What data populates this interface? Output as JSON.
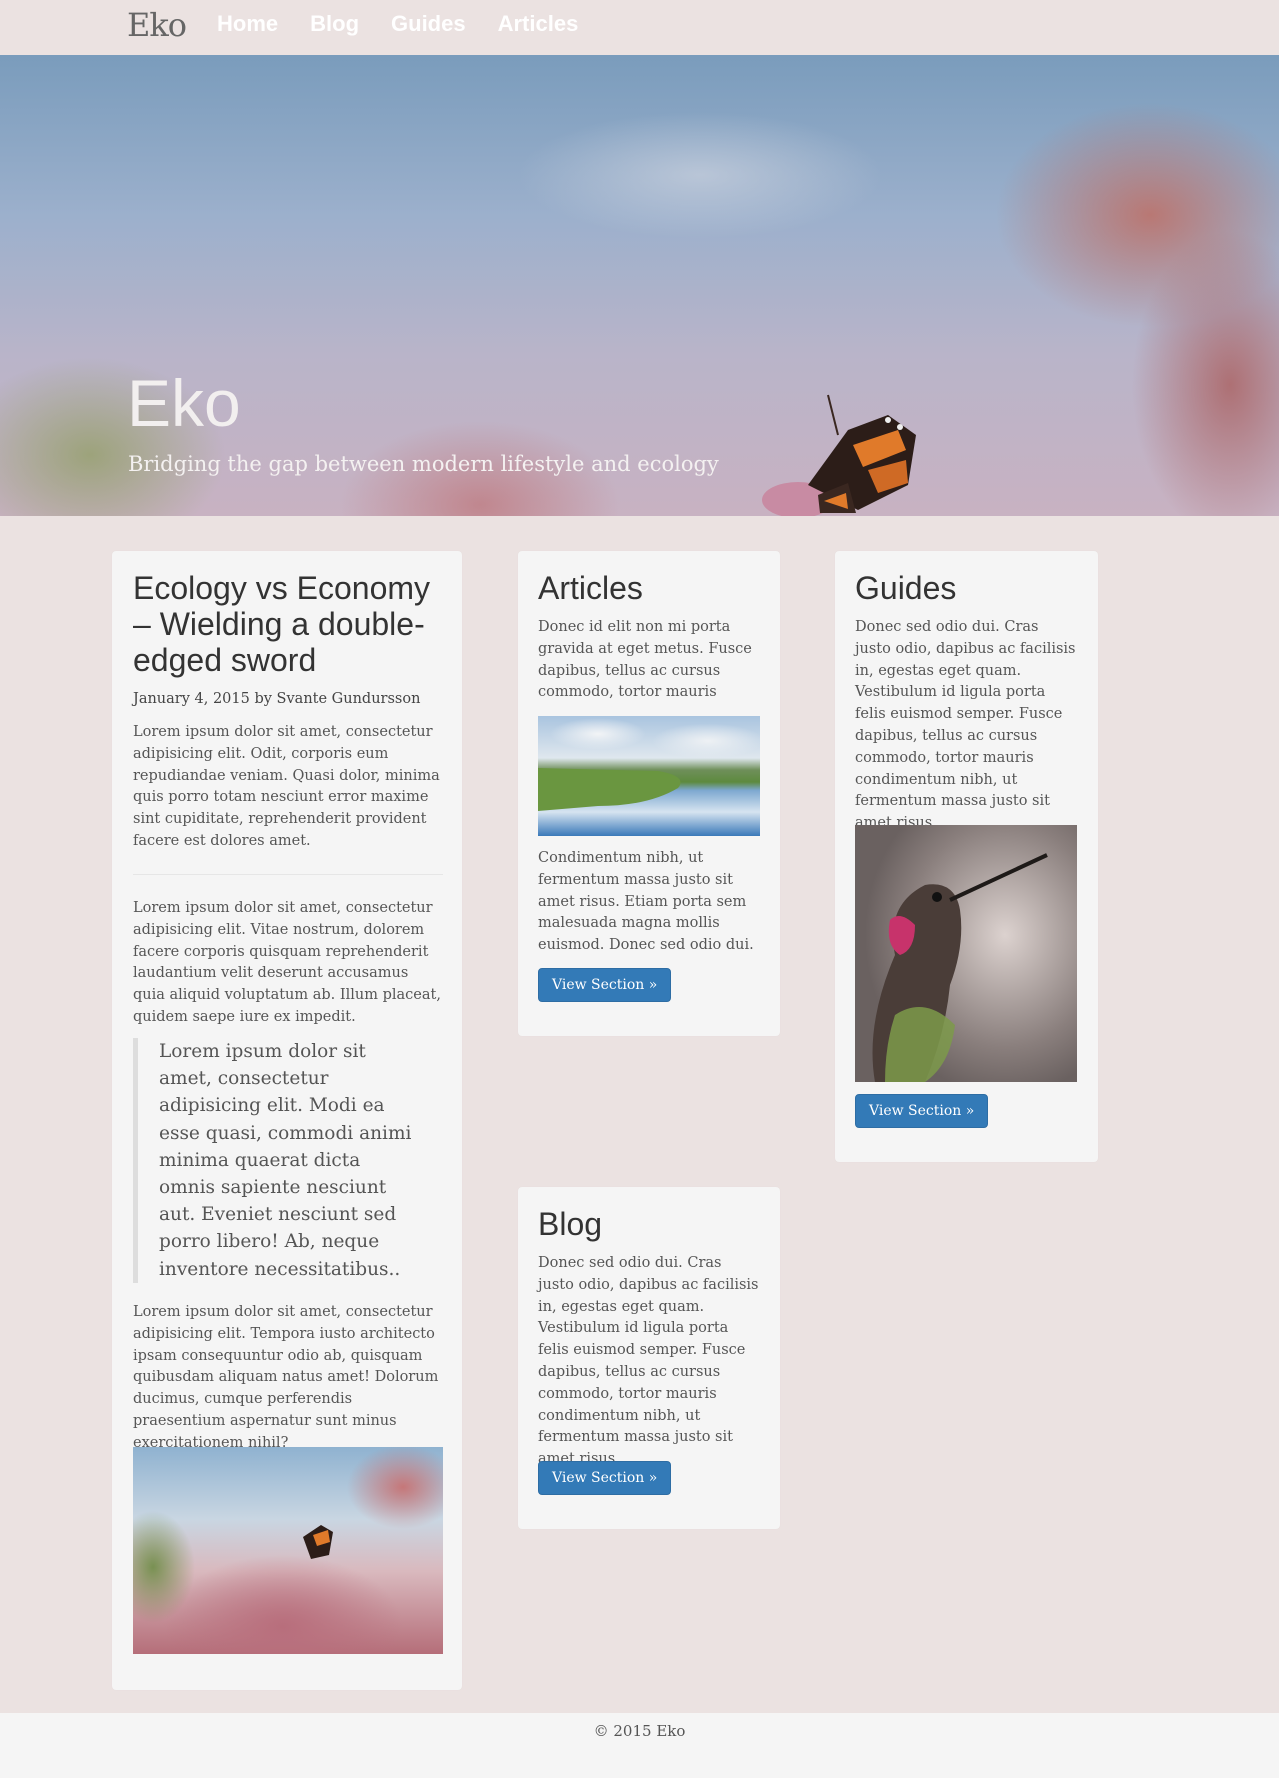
{
  "nav": {
    "brand": "Eko",
    "links": [
      "Home",
      "Blog",
      "Guides",
      "Articles"
    ]
  },
  "hero": {
    "title": "Eko",
    "subtitle": "Bridging the gap between modern lifestyle and ecology"
  },
  "post": {
    "title": "Ecology vs Economy – Wielding a double-edged sword",
    "meta": "January 4, 2015 by Svante Gundursson",
    "para1": "Lorem ipsum dolor sit amet, consectetur adipisicing elit. Odit, corporis eum repudiandae veniam. Quasi dolor, minima quis porro totam nesciunt error maxime sint cupiditate, reprehenderit provident facere est dolores amet.",
    "para2": "Lorem ipsum dolor sit amet, consectetur adipisicing elit. Vitae nostrum, dolorem facere corporis quisquam reprehenderit laudantium velit deserunt accusamus quia aliquid voluptatum ab. Illum placeat, quidem saepe iure ex impedit.",
    "quote": "Lorem ipsum dolor sit amet, consectetur adipisicing elit. Modi ea esse quasi, commodi animi minima quaerat dicta omnis sapiente nesciunt aut. Eveniet nesciunt sed porro libero! Ab, neque inventore necessitatibus..",
    "para3": "Lorem ipsum dolor sit amet, consectetur adipisicing elit. Tempora iusto architecto ipsam consequuntur odio ab, quisquam quibusdam aliquam natus amet! Dolorum ducimus, cumque perferendis praesentium aspernatur sunt minus exercitationem nihil?"
  },
  "articles": {
    "title": "Articles",
    "text1": "Donec id elit non mi porta gravida at eget metus. Fusce dapibus, tellus ac cursus commodo, tortor mauris",
    "text2": "Condimentum nibh, ut fermentum massa justo sit amet risus. Etiam porta sem malesuada magna mollis euismod. Donec sed odio dui.",
    "button": "View Section »"
  },
  "guides": {
    "title": "Guides",
    "text": "Donec sed odio dui. Cras justo odio, dapibus ac facilisis in, egestas eget quam. Vestibulum id ligula porta felis euismod semper. Fusce dapibus, tellus ac cursus commodo, tortor mauris condimentum nibh, ut fermentum massa justo sit amet risus.",
    "button": "View Section »"
  },
  "blog": {
    "title": "Blog",
    "text": "Donec sed odio dui. Cras justo odio, dapibus ac facilisis in, egestas eget quam. Vestibulum id ligula porta felis euismod semper. Fusce dapibus, tellus ac cursus commodo, tortor mauris condimentum nibh, ut fermentum massa justo sit amet risus.",
    "button": "View Section »"
  },
  "footer": {
    "text": "© 2015 Eko"
  },
  "colors": {
    "background": "#ebe2e1",
    "card": "#f5f5f5",
    "button": "#337ab7",
    "nav_text": "#ffffff"
  }
}
